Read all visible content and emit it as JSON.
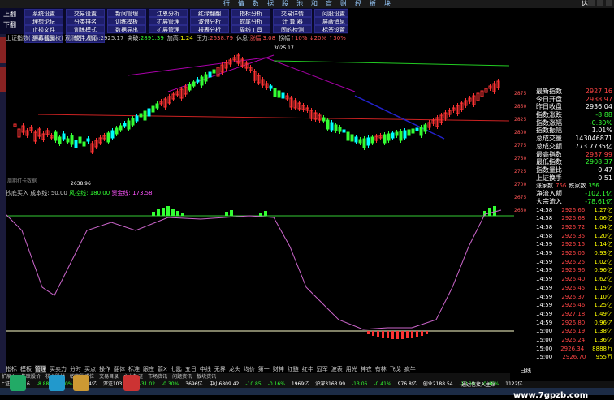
{
  "titlebar": {
    "items": [
      "行",
      "情",
      "数",
      "据",
      "股",
      "池",
      "和",
      "盲",
      "财",
      "经",
      "板",
      "块"
    ],
    "logo": "达龙"
  },
  "menu": {
    "left": [
      "上翻",
      "下翻"
    ],
    "grid": [
      "系统设置",
      "交易设置",
      "新闻管理",
      "江恩分析",
      "红绿翻翻",
      "指标分析",
      "交易详情",
      "问股设置",
      "理想论坛",
      "分类排名",
      "训练模板",
      "扩展管理",
      "波浪分析",
      "蛇尾分析",
      "计 算 器",
      "屏蔽消息",
      "止损文件",
      "训练模式",
      "数据导出",
      "扩展管理",
      "报表分析",
      "周线工具",
      "固的检测",
      "标签设置",
      "屏幕截图",
      "软件大师"
    ]
  },
  "main_header": {
    "title": "上证指数(日线 前复权)",
    "subtitle": "观测区",
    "items": [
      {
        "k": "重心:",
        "v": "2925.17",
        "c": ""
      },
      {
        "k": "突破:",
        "v": "2891.39",
        "c": "g"
      },
      {
        "k": "加高:",
        "v": "1.24",
        "c": "y"
      },
      {
        "k": "压力:",
        "v": "2638.79",
        "c": "r"
      },
      {
        "k": "休息·",
        "v": "涨幅 3.08",
        "c": "r"
      },
      {
        "k": "拐幅",
        "v": "↑10% ↓20% ↑30% ↓5%",
        "c": "r"
      }
    ]
  },
  "ind_header": {
    "name": "抄底买入",
    "cost_label": "成本线:",
    "cost_value": "50.00",
    "label2": "风控线:",
    "label3": "资金线:",
    "value2": "180.00",
    "value3": "173.58"
  },
  "right_axis": [
    "2875",
    "2850",
    "2825",
    "2800",
    "2775",
    "2750",
    "2725",
    "2700",
    "2675",
    "2650"
  ],
  "stats": [
    {
      "k": "最新指数",
      "v": "2927.16",
      "c": "red"
    },
    {
      "k": "今日开盘",
      "v": "2938.97",
      "c": "red"
    },
    {
      "k": "昨日收盘",
      "v": "2936.04",
      "c": "white"
    },
    {
      "k": "指数涨跌",
      "v": "-8.88",
      "c": "green"
    },
    {
      "k": "指数涨幅",
      "v": "-0.30%",
      "c": "green"
    },
    {
      "k": "指数振幅",
      "v": "1.01%",
      "c": "white"
    },
    {
      "k": "总成交量",
      "v": "143046871",
      "c": "white"
    },
    {
      "k": "总成交额",
      "v": "1773.7735亿",
      "c": "white"
    },
    {
      "k": "最高指数",
      "v": "2937.99",
      "c": "red"
    },
    {
      "k": "最低指数",
      "v": "2908.37",
      "c": "green"
    },
    {
      "k": "指数量比",
      "v": "0.47",
      "c": "white"
    },
    {
      "k": "上证换手",
      "v": "0.51",
      "c": "white"
    }
  ],
  "flow": {
    "up_label": "涨家数",
    "up_value": "756",
    "down_label": "跌家数",
    "down_value": "356",
    "net_label": "净流入额",
    "net_value": "-102.1亿",
    "big_label": "大宗流入",
    "big_value": "-78.61亿"
  },
  "trades": [
    {
      "t": "14:58",
      "p": "2926.66",
      "v": "1.27亿"
    },
    {
      "t": "14:58",
      "p": "2926.68",
      "v": "1.06亿"
    },
    {
      "t": "14:58",
      "p": "2926.72",
      "v": "1.04亿"
    },
    {
      "t": "14:58",
      "p": "2926.35",
      "v": "1.20亿"
    },
    {
      "t": "14:59",
      "p": "2926.15",
      "v": "1.14亿"
    },
    {
      "t": "14:59",
      "p": "2926.05",
      "v": "0.93亿"
    },
    {
      "t": "14:59",
      "p": "2926.25",
      "v": "1.02亿"
    },
    {
      "t": "14:59",
      "p": "2925.96",
      "v": "0.96亿"
    },
    {
      "t": "14:59",
      "p": "2926.40",
      "v": "1.62亿"
    },
    {
      "t": "14:59",
      "p": "2926.45",
      "v": "1.15亿"
    },
    {
      "t": "14:59",
      "p": "2926.37",
      "v": "1.10亿"
    },
    {
      "t": "14:59",
      "p": "2926.46",
      "v": "1.25亿"
    },
    {
      "t": "14:59",
      "p": "2927.18",
      "v": "1.49亿"
    },
    {
      "t": "14:59",
      "p": "2926.80",
      "v": "0.96亿"
    },
    {
      "t": "15:00",
      "p": "2926.19",
      "v": "1.38亿"
    },
    {
      "t": "15:00",
      "p": "2926.24",
      "v": "1.36亿"
    },
    {
      "t": "15:00",
      "p": "2926.34",
      "v": "8888万"
    },
    {
      "t": "15:00",
      "p": "2926.70",
      "v": "955万"
    }
  ],
  "bottom_tabs": [
    "指标",
    "模板",
    "管理",
    "买卖力",
    "分时",
    "买点",
    "操作",
    "翻体",
    "标准",
    "跟庄",
    "箭X",
    "七匙",
    "五日",
    "中线",
    "无界",
    "龙头",
    "均价",
    "第一",
    "财神",
    "红鲢",
    "红牛",
    "冠军",
    "波表",
    "用光",
    "神农",
    "有林",
    "飞戈",
    "疯牛"
  ],
  "sub_tabs": [
    "扩展入",
    "失联股价",
    "核心股材",
    "敏宽队成位",
    "交易目录",
    "主力轨迹",
    "市场资讯",
    "问题资讯",
    "板块资讯"
  ],
  "ticker": [
    {
      "t": "上证2927.16",
      "c": "w"
    },
    {
      "t": "-8.88",
      "c": "g"
    },
    {
      "t": "-0.30%",
      "c": "g"
    },
    {
      "t": "1774亿",
      "c": "w"
    },
    {
      "t": "深证10316.0",
      "c": "w"
    },
    {
      "t": "-31.02",
      "c": "g"
    },
    {
      "t": "-0.30%",
      "c": "g"
    },
    {
      "t": "3696亿",
      "c": "w"
    },
    {
      "t": "中小6809.42",
      "c": "w"
    },
    {
      "t": "-10.85",
      "c": "g"
    },
    {
      "t": "-0.16%",
      "c": "g"
    },
    {
      "t": "1969亿",
      "c": "w"
    },
    {
      "t": "沪深3163.99",
      "c": "w"
    },
    {
      "t": "-13.06",
      "c": "g"
    },
    {
      "t": "-0.41%",
      "c": "g"
    },
    {
      "t": "976.8亿",
      "c": "w"
    },
    {
      "t": "创业2188.54",
      "c": "w"
    },
    {
      "t": "-10.19",
      "c": "g"
    },
    {
      "t": "-0.46%",
      "c": "g"
    },
    {
      "t": "1122亿",
      "c": "w"
    }
  ],
  "chart_labels": {
    "low_label": "2638.96",
    "high_label": "3025.17",
    "period_label": "周期打卡数据"
  },
  "right_label": "日线",
  "connect_text": "通达信接入主站",
  "watermark": "www.7gpzb.com",
  "colors": {
    "up": "#ff3333",
    "down": "#33ff33",
    "cyan": "#00ffff",
    "yellow": "#ffff00",
    "magenta": "#cc66cc"
  }
}
